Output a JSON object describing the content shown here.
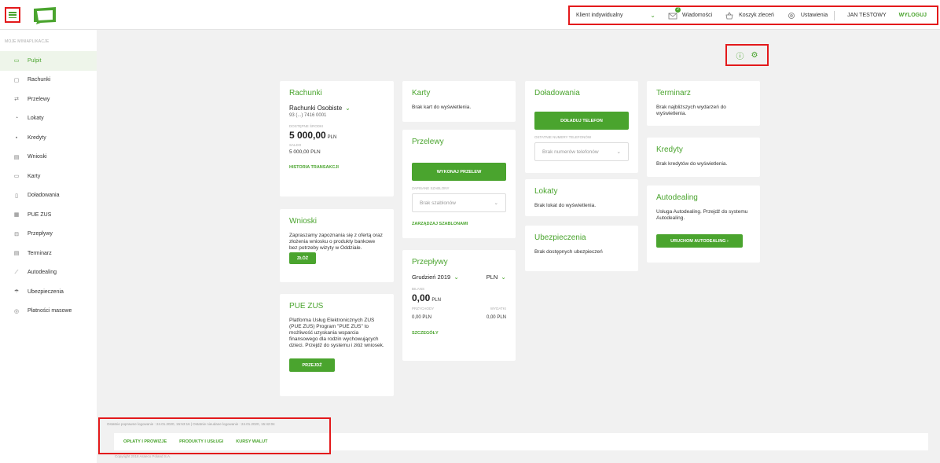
{
  "topbar": {
    "client": "Klient indywidualny",
    "messages": "Wiadomości",
    "messages_badge": "2",
    "cart": "Koszyk zleceń",
    "settings": "Ustawienia",
    "user": "JAN TESTOWY",
    "logout": "WYLOGUJ"
  },
  "sidebar": {
    "section": "MOJE MINIAPLIKACJE",
    "items": [
      {
        "label": "Pulpit",
        "icon": "dashboard-icon"
      },
      {
        "label": "Rachunki",
        "icon": "wallet-icon"
      },
      {
        "label": "Przelewy",
        "icon": "transfer-icon"
      },
      {
        "label": "Lokaty",
        "icon": "deposit-icon"
      },
      {
        "label": "Kredyty",
        "icon": "loan-icon"
      },
      {
        "label": "Wnioski",
        "icon": "application-icon"
      },
      {
        "label": "Karty",
        "icon": "card-icon"
      },
      {
        "label": "Doładowania",
        "icon": "phone-icon"
      },
      {
        "label": "PUE ZUS",
        "icon": "zus-icon"
      },
      {
        "label": "Przepływy",
        "icon": "flows-icon"
      },
      {
        "label": "Terminarz",
        "icon": "calendar-icon"
      },
      {
        "label": "Autodealing",
        "icon": "chart-icon"
      },
      {
        "label": "Ubezpieczenia",
        "icon": "umbrella-icon"
      },
      {
        "label": "Płatności masowe",
        "icon": "bulk-payment-icon"
      }
    ]
  },
  "rachunki": {
    "title": "Rachunki",
    "account_name": "Rachunki Osobiste",
    "account_number": "93 (...) 7416 0001",
    "available_label": "DOSTĘPNE ŚRODKI",
    "available_value": "5 000,00",
    "currency": "PLN",
    "saldo_label": "SALDO",
    "saldo_value": "5 000,00 PLN",
    "history_link": "HISTORIA TRANSAKCJI"
  },
  "wnioski": {
    "title": "Wnioski",
    "text": "Zapraszamy zapoznania się z ofertą oraz złożenia wniosku o produkty bankowe bez potrzeby wizyty w Oddziale.",
    "button": "ZŁÓŻ"
  },
  "pue": {
    "title": "PUE ZUS",
    "text": "Platforma Usług Elektronicznych ZUS (PUE ZUS) Program \"PUE ZUS\" to możliwość uzyskania wsparcia finansowego dla rodzin wychowujących dzieci. Przejdź do systemu i złóż wniosek.",
    "button": "PRZEJDŹ"
  },
  "karty": {
    "title": "Karty",
    "empty": "Brak kart do wyświetlenia."
  },
  "przelewy": {
    "title": "Przelewy",
    "button": "WYKONAJ PRZELEW",
    "templates_label": "ZAPISANE SZABLONY",
    "templates_placeholder": "Brak szablonów",
    "manage_link": "ZARZĄDZAJ SZABLONAMI"
  },
  "przeplywy": {
    "title": "Przepływy",
    "month": "Grudzień 2019",
    "currency": "PLN",
    "bilans_label": "BILANS",
    "bilans_value": "0,00",
    "income_label": "PRZYCHODY",
    "expense_label": "WYDATKI",
    "income_value": "0,00 PLN",
    "expense_value": "0,00 PLN",
    "details_link": "SZCZEGÓŁY"
  },
  "doladowania": {
    "title": "Doładowania",
    "button": "DOŁADUJ TELEFON",
    "recent_label": "OSTATNIE NUMERY TELEFONÓW",
    "recent_placeholder": "Brak numerów telefonów"
  },
  "lokaty": {
    "title": "Lokaty",
    "empty": "Brak lokat do wyświetlenia."
  },
  "ubezpieczenia": {
    "title": "Ubezpieczenia",
    "empty": "Brak dostępnych ubezpieczeń"
  },
  "terminarz": {
    "title": "Terminarz",
    "empty": "Brak najbliższych wydarzeń do wyświetlenia."
  },
  "kredyty": {
    "title": "Kredyty",
    "empty": "Brak kredytów do wyświetlenia."
  },
  "autodealing": {
    "title": "Autodealing",
    "text": "Usługa Autodealing. Przejdź do systemu Autodealing.",
    "button": "URUCHOM AUTODEALING ›"
  },
  "footer": {
    "login_info": "Ostatnie poprawne logowanie : 24.01.2020, 15:53:16  |  Ostatnie nieudane logowanie : 24.01.2020, 15:42:04",
    "links": [
      "OPŁATY I PROWIZJE",
      "PRODUKTY I USŁUGI",
      "KURSY WALUT"
    ],
    "copyright": "Copyright 2018 Asseco Poland S.A."
  }
}
